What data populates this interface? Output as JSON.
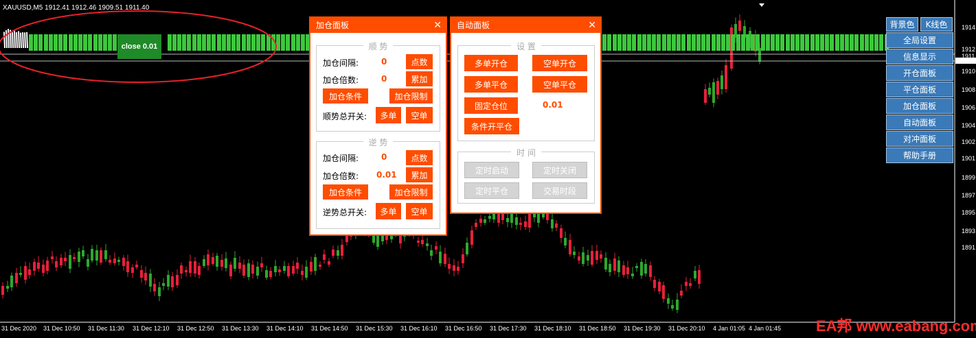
{
  "chart": {
    "symbol_info": "XAUUSD,M5  1912.41 1912.46 1909.51 1911.40",
    "price_labels": [
      "1914",
      "1912",
      "1911",
      "1910",
      "1908",
      "1906",
      "1904",
      "1902",
      "1901",
      "1899",
      "1897",
      "1895",
      "1893",
      "1891"
    ],
    "time_labels": [
      "31 Dec 2020",
      "31 Dec 10:50",
      "31 Dec 11:30",
      "31 Dec 12:10",
      "31 Dec 12:50",
      "31 Dec 13:30",
      "31 Dec 14:10",
      "31 Dec 14:50",
      "31 Dec 15:30",
      "31 Dec 16:10",
      "31 Dec 16:50",
      "31 Dec 17:30",
      "31 Dec 18:10",
      "31 Dec 18:50",
      "31 Dec 19:30",
      "31 Dec 20:10",
      "4 Jan 01:05",
      "4 Jan 01:45"
    ],
    "bull_color": "#2ea82e",
    "bear_color": "#e8203a",
    "close_button_label": "close 0.01",
    "watermark": "EA邦 www.eabang.com"
  },
  "add_panel": {
    "title": "加仓面板",
    "trend": {
      "title": "顺    势",
      "interval_label": "加仓间隔:",
      "interval_value": "0",
      "points_button": "点数",
      "multiplier_label": "加仓倍数:",
      "multiplier_value": "0",
      "accumulate_button": "累加",
      "condition_button": "加仓条件",
      "limit_button": "加仓限制",
      "switch_label": "顺势总开关:",
      "long_button": "多单",
      "short_button": "空单"
    },
    "counter": {
      "title": "逆    势",
      "interval_label": "加仓间隔:",
      "interval_value": "0",
      "points_button": "点数",
      "multiplier_label": "加仓倍数:",
      "multiplier_value": "0.01",
      "accumulate_button": "累加",
      "condition_button": "加仓条件",
      "limit_button": "加仓限制",
      "switch_label": "逆势总开关:",
      "long_button": "多单",
      "short_button": "空单"
    }
  },
  "auto_panel": {
    "title": "自动面板",
    "settings": {
      "title": "设    置",
      "long_open": "多单开仓",
      "short_open": "空单开仓",
      "long_close": "多单平仓",
      "short_close": "空单平仓",
      "fixed_lot": "固定仓位",
      "fixed_lot_value": "0.01",
      "conditional": "条件开平仓"
    },
    "time": {
      "title": "时    间",
      "timed_start": "定时启动",
      "timed_stop": "定时关闭",
      "timed_close": "定时平仓",
      "trade_session": "交易时段"
    }
  },
  "right_menu": {
    "bg_color": "背景色",
    "candle_color": "K线色",
    "items": [
      "全局设置",
      "信息显示",
      "开仓面板",
      "平仓面板",
      "加仓面板",
      "自动面板",
      "对冲面板",
      "帮助手册"
    ]
  }
}
